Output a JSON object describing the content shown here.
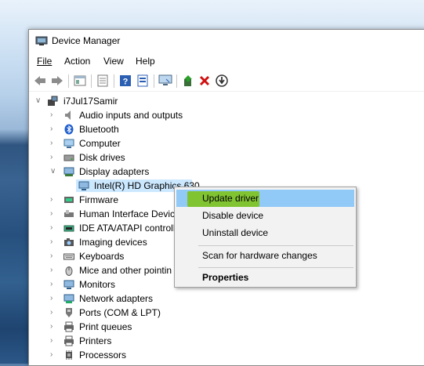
{
  "window": {
    "title": "Device Manager"
  },
  "menu": {
    "file": "File",
    "action": "Action",
    "view": "View",
    "help": "Help"
  },
  "toolbar": {
    "buttons": [
      "back-icon",
      "forward-icon",
      "properties-pane-icon",
      "help-pane-icon",
      "help-icon",
      "show-hidden-icon",
      "monitor-icon",
      "add-driver-icon",
      "remove-device-icon",
      "download-icon"
    ]
  },
  "tree": {
    "root": "i7Jul17Samir",
    "items": [
      {
        "label": "Audio inputs and outputs",
        "icon": "speaker-icon"
      },
      {
        "label": "Bluetooth",
        "icon": "bluetooth-icon"
      },
      {
        "label": "Computer",
        "icon": "computer-icon"
      },
      {
        "label": "Disk drives",
        "icon": "disk-icon"
      },
      {
        "label": "Display adapters",
        "icon": "display-adapter-icon"
      },
      {
        "label": "Intel(R) HD Graphics 630",
        "icon": "monitor-icon"
      },
      {
        "label": "Firmware",
        "icon": "firmware-icon"
      },
      {
        "label": "Human Interface Devic",
        "icon": "hid-icon"
      },
      {
        "label": "IDE ATA/ATAPI controlle",
        "icon": "ide-icon"
      },
      {
        "label": "Imaging devices",
        "icon": "camera-icon"
      },
      {
        "label": "Keyboards",
        "icon": "keyboard-icon"
      },
      {
        "label": "Mice and other pointin",
        "icon": "mouse-icon"
      },
      {
        "label": "Monitors",
        "icon": "monitor-icon"
      },
      {
        "label": "Network adapters",
        "icon": "network-icon"
      },
      {
        "label": "Ports (COM & LPT)",
        "icon": "port-icon"
      },
      {
        "label": "Print queues",
        "icon": "printer-icon"
      },
      {
        "label": "Printers",
        "icon": "printer-icon"
      },
      {
        "label": "Processors",
        "icon": "processor-icon"
      }
    ]
  },
  "context_menu": {
    "update": "Update driver",
    "disable": "Disable device",
    "uninstall": "Uninstall device",
    "scan": "Scan for hardware changes",
    "properties": "Properties"
  },
  "colors": {
    "highlight": "#91c9f7",
    "marker": "#7fc31c",
    "selection": "#cce8ff"
  }
}
